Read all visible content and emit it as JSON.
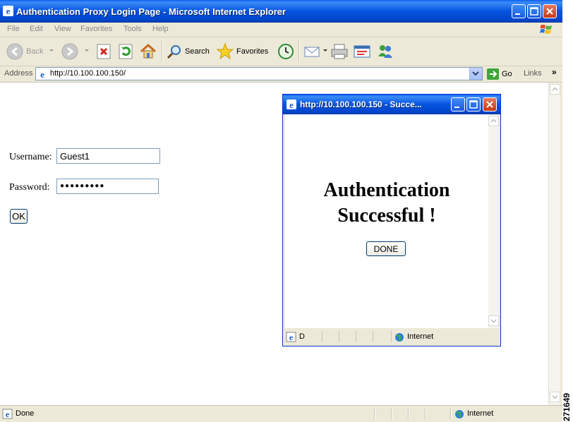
{
  "window": {
    "title": "Authentication Proxy Login Page - Microsoft Internet Explorer"
  },
  "menu": [
    "File",
    "Edit",
    "View",
    "Favorites",
    "Tools",
    "Help"
  ],
  "toolbar": {
    "back_label": "Back",
    "search_label": "Search",
    "favorites_label": "Favorites"
  },
  "address": {
    "label": "Address",
    "url": "http://10.100.100.150/",
    "go_label": "Go",
    "links_label": "Links",
    "links_chevron": "»"
  },
  "form": {
    "username_label": "Username:",
    "username_value": "Guest1",
    "password_label": "Password:",
    "password_value": "●●●●●●●●●",
    "ok_label": "OK"
  },
  "popup": {
    "title": "http://10.100.100.150 - Succe...",
    "message_line1": "Authentication",
    "message_line2": "Successful !",
    "done_label": "DONE",
    "status_left": "D",
    "status_zone": "Internet"
  },
  "status": {
    "text": "Done",
    "zone": "Internet"
  },
  "figure_id": "271649",
  "colors": {
    "titlebar": "#0553e0",
    "chrome": "#ece9d8",
    "close_button": "#c63a14"
  }
}
